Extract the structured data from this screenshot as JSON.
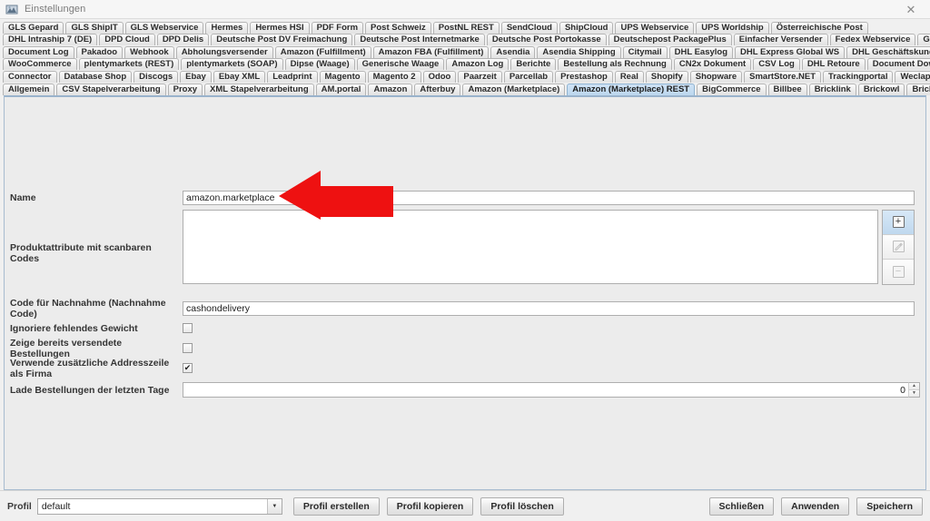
{
  "window": {
    "title": "Einstellungen",
    "icon": "app-icon",
    "close_label": "✕"
  },
  "tab_rows": [
    [
      {
        "label": "GLS Gepard",
        "selected": false
      },
      {
        "label": "GLS ShipIT",
        "selected": false
      },
      {
        "label": "GLS Webservice",
        "selected": false
      },
      {
        "label": "Hermes",
        "selected": false
      },
      {
        "label": "Hermes HSI",
        "selected": false
      },
      {
        "label": "PDF Form",
        "selected": false
      },
      {
        "label": "Post Schweiz",
        "selected": false
      },
      {
        "label": "PostNL REST",
        "selected": false
      },
      {
        "label": "SendCloud",
        "selected": false
      },
      {
        "label": "ShipCloud",
        "selected": false
      },
      {
        "label": "UPS Webservice",
        "selected": false
      },
      {
        "label": "UPS Worldship",
        "selected": false
      },
      {
        "label": "Österreichische Post",
        "selected": false
      }
    ],
    [
      {
        "label": "DHL Intraship 7 (DE)",
        "selected": false
      },
      {
        "label": "DPD Cloud",
        "selected": false
      },
      {
        "label": "DPD Delis",
        "selected": false
      },
      {
        "label": "Deutsche Post DV Freimachung",
        "selected": false
      },
      {
        "label": "Deutsche Post Internetmarke",
        "selected": false
      },
      {
        "label": "Deutsche Post Portokasse",
        "selected": false
      },
      {
        "label": "Deutschepost PackagePlus",
        "selected": false
      },
      {
        "label": "Einfacher Versender",
        "selected": false
      },
      {
        "label": "Fedex Webservice",
        "selected": false
      },
      {
        "label": "GEL Express",
        "selected": false
      }
    ],
    [
      {
        "label": "Document Log",
        "selected": false
      },
      {
        "label": "Pakadoo",
        "selected": false
      },
      {
        "label": "Webhook",
        "selected": false
      },
      {
        "label": "Abholungsversender",
        "selected": false
      },
      {
        "label": "Amazon (Fulfillment)",
        "selected": false
      },
      {
        "label": "Amazon FBA (Fulfillment)",
        "selected": false
      },
      {
        "label": "Asendia",
        "selected": false
      },
      {
        "label": "Asendia Shipping",
        "selected": false
      },
      {
        "label": "Citymail",
        "selected": false
      },
      {
        "label": "DHL Easylog",
        "selected": false
      },
      {
        "label": "DHL Express Global WS",
        "selected": false
      },
      {
        "label": "DHL Geschäftskundenversand",
        "selected": false
      }
    ],
    [
      {
        "label": "WooCommerce",
        "selected": false
      },
      {
        "label": "plentymarkets (REST)",
        "selected": false
      },
      {
        "label": "plentymarkets (SOAP)",
        "selected": false
      },
      {
        "label": "Dipse (Waage)",
        "selected": false
      },
      {
        "label": "Generische Waage",
        "selected": false
      },
      {
        "label": "Amazon Log",
        "selected": false
      },
      {
        "label": "Berichte",
        "selected": false
      },
      {
        "label": "Bestellung als Rechnung",
        "selected": false
      },
      {
        "label": "CN2x Dokument",
        "selected": false
      },
      {
        "label": "CSV Log",
        "selected": false
      },
      {
        "label": "DHL Retoure",
        "selected": false
      },
      {
        "label": "Document Downloader",
        "selected": false
      }
    ],
    [
      {
        "label": "Connector",
        "selected": false
      },
      {
        "label": "Database Shop",
        "selected": false
      },
      {
        "label": "Discogs",
        "selected": false
      },
      {
        "label": "Ebay",
        "selected": false
      },
      {
        "label": "Ebay XML",
        "selected": false
      },
      {
        "label": "Leadprint",
        "selected": false
      },
      {
        "label": "Magento",
        "selected": false
      },
      {
        "label": "Magento 2",
        "selected": false
      },
      {
        "label": "Odoo",
        "selected": false
      },
      {
        "label": "Paarzeit",
        "selected": false
      },
      {
        "label": "Parcellab",
        "selected": false
      },
      {
        "label": "Prestashop",
        "selected": false
      },
      {
        "label": "Real",
        "selected": false
      },
      {
        "label": "Shopify",
        "selected": false
      },
      {
        "label": "Shopware",
        "selected": false
      },
      {
        "label": "SmartStore.NET",
        "selected": false
      },
      {
        "label": "Trackingportal",
        "selected": false
      },
      {
        "label": "Weclapp",
        "selected": false
      }
    ],
    [
      {
        "label": "Allgemein",
        "selected": false
      },
      {
        "label": "CSV Stapelverarbeitung",
        "selected": false
      },
      {
        "label": "Proxy",
        "selected": false
      },
      {
        "label": "XML Stapelverarbeitung",
        "selected": false
      },
      {
        "label": "AM.portal",
        "selected": false
      },
      {
        "label": "Amazon",
        "selected": false
      },
      {
        "label": "Afterbuy",
        "selected": false
      },
      {
        "label": "Amazon (Marketplace)",
        "selected": false
      },
      {
        "label": "Amazon (Marketplace) REST",
        "selected": true
      },
      {
        "label": "BigCommerce",
        "selected": false
      },
      {
        "label": "Billbee",
        "selected": false
      },
      {
        "label": "Bricklink",
        "selected": false
      },
      {
        "label": "Brickowl",
        "selected": false
      },
      {
        "label": "Brickscout",
        "selected": false
      }
    ]
  ],
  "form": {
    "name": {
      "label": "Name",
      "value": "amazon.marketplace",
      "placeholder": ""
    },
    "product_attributes": {
      "label": "Produktattribute mit scanbaren Codes",
      "items": []
    },
    "list_buttons": [
      {
        "name": "add-attribute-button",
        "glyph": "⊞",
        "state": "active"
      },
      {
        "name": "edit-attribute-button",
        "glyph": "✎",
        "state": "disabled"
      },
      {
        "name": "remove-attribute-button",
        "glyph": "⊟",
        "state": "disabled"
      }
    ],
    "cod_code": {
      "label": "Code für Nachnahme (Nachnahme Code)",
      "value": "cashondelivery",
      "placeholder": ""
    },
    "ignore_missing_weight": {
      "label": "Ignoriere fehlendes Gewicht",
      "checked": false
    },
    "show_shipped_orders": {
      "label": "Zeige bereits versendete Bestellungen",
      "checked": false
    },
    "use_extra_address_line_as_company": {
      "label": "Verwende zusätzliche Addresszeile als Firma",
      "checked": true
    },
    "load_orders_last_days": {
      "label": "Lade Bestellungen der letzten Tage",
      "value": "0"
    }
  },
  "footer": {
    "profil_label": "Profil",
    "profil_value": "default",
    "profil_options": [
      "default"
    ],
    "buttons_left": [
      {
        "name": "create-profile-button",
        "label": "Profil erstellen"
      },
      {
        "name": "copy-profile-button",
        "label": "Profil kopieren"
      },
      {
        "name": "delete-profile-button",
        "label": "Profil löschen"
      }
    ],
    "buttons_right": [
      {
        "name": "close-button",
        "label": "Schließen"
      },
      {
        "name": "apply-button",
        "label": "Anwenden"
      },
      {
        "name": "save-button",
        "label": "Speichern"
      }
    ]
  },
  "annotation": {
    "arrow_color": "#ee1111",
    "points_to": "name-input"
  }
}
